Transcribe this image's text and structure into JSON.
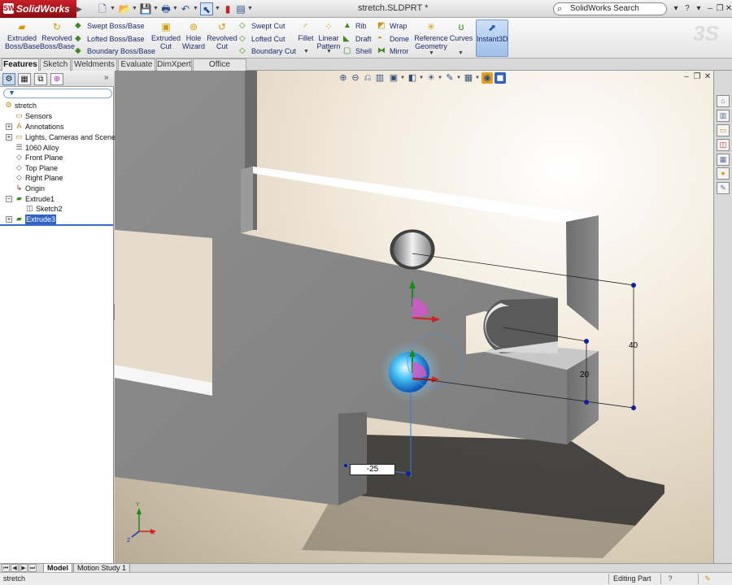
{
  "app": {
    "name": "SolidWorks",
    "logo_mark": "SW",
    "document_title": "stretch.SLDPRT *"
  },
  "search": {
    "label": "SolidWorks Search"
  },
  "command_manager": {
    "large": [
      {
        "label1": "Extruded",
        "label2": "Boss/Base",
        "icon": "extruded-boss-icon"
      },
      {
        "label1": "Revolved",
        "label2": "Boss/Base",
        "icon": "revolved-boss-icon"
      },
      {
        "label1": "Extruded",
        "label2": "Cut",
        "icon": "extruded-cut-icon"
      },
      {
        "label1": "Hole",
        "label2": "Wizard",
        "icon": "hole-wizard-icon"
      },
      {
        "label1": "Revolved",
        "label2": "Cut",
        "icon": "revolved-cut-icon"
      },
      {
        "label1": "Fillet",
        "label2": "",
        "icon": "fillet-icon"
      },
      {
        "label1": "Linear",
        "label2": "Pattern",
        "icon": "linear-pattern-icon"
      },
      {
        "label1": "Reference",
        "label2": "Geometry",
        "icon": "reference-geometry-icon"
      },
      {
        "label1": "Curves",
        "label2": "",
        "icon": "curves-icon"
      },
      {
        "label1": "Instant3D",
        "label2": "",
        "icon": "instant3d-icon"
      }
    ],
    "small": [
      {
        "label": "Swept Boss/Base",
        "icon": "swept-boss-icon"
      },
      {
        "label": "Lofted Boss/Base",
        "icon": "lofted-boss-icon"
      },
      {
        "label": "Boundary Boss/Base",
        "icon": "boundary-boss-icon"
      },
      {
        "label": "Swept Cut",
        "icon": "swept-cut-icon"
      },
      {
        "label": "Lofted Cut",
        "icon": "lofted-cut-icon"
      },
      {
        "label": "Boundary Cut",
        "icon": "boundary-cut-icon"
      },
      {
        "label": "Rib",
        "icon": "rib-icon"
      },
      {
        "label": "Draft",
        "icon": "draft-icon"
      },
      {
        "label": "Shell",
        "icon": "shell-icon"
      },
      {
        "label": "Wrap",
        "icon": "wrap-icon"
      },
      {
        "label": "Dome",
        "icon": "dome-icon"
      },
      {
        "label": "Mirror",
        "icon": "mirror-icon"
      }
    ]
  },
  "tabs": [
    "Features",
    "Sketch",
    "Weldments",
    "Evaluate",
    "DimXpert",
    "Office Products"
  ],
  "tree": {
    "root": "stretch",
    "items": [
      "Sensors",
      "Annotations",
      "Lights, Cameras and Scene",
      "1060 Alloy",
      "Front Plane",
      "Top Plane",
      "Right Plane",
      "Origin",
      "Extrude1",
      "Sketch2",
      "Extrude3"
    ]
  },
  "viewport": {
    "dimension_input": "-25",
    "dim_20": "20",
    "dim_40": "40",
    "triad": {
      "x": "X",
      "y": "Y",
      "z": "Z"
    }
  },
  "bottom_tabs": [
    "Model",
    "Motion Study 1"
  ],
  "status": {
    "left": "stretch",
    "right": "Editing Part"
  },
  "colors": {
    "brand": "#b0151c",
    "selection": "#3163c5",
    "dimension": "#1020a0"
  }
}
